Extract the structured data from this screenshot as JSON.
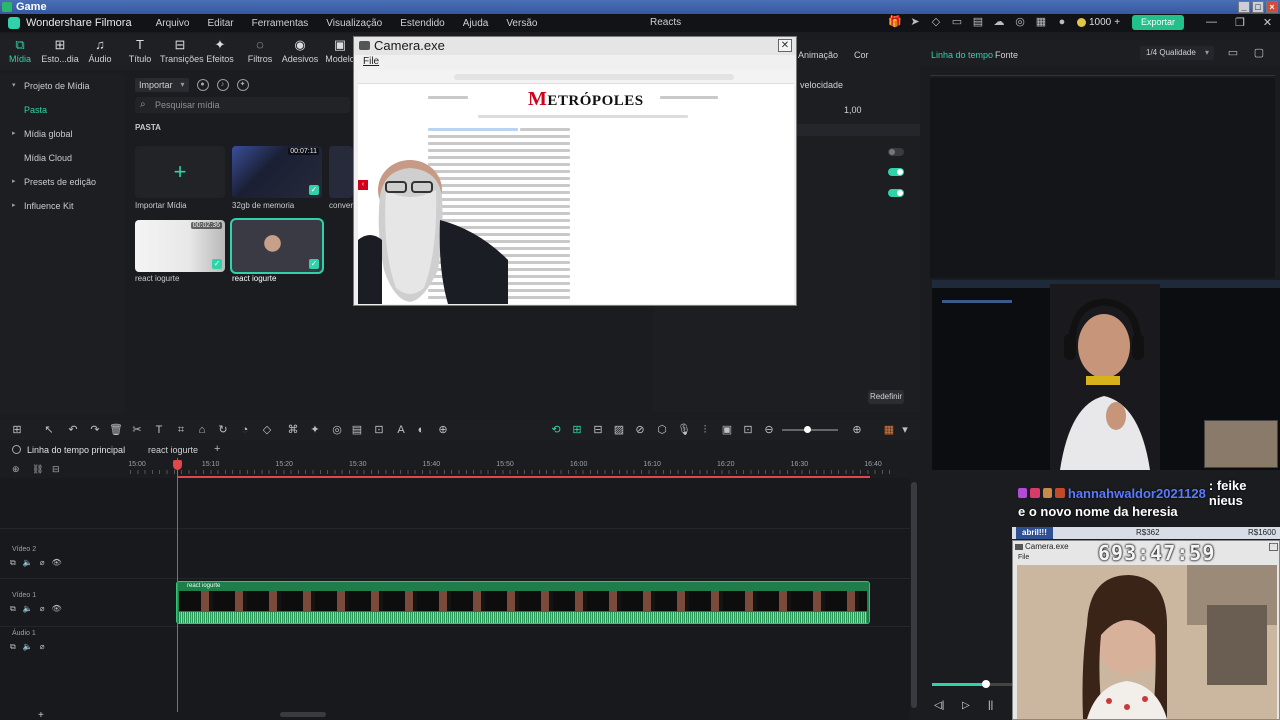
{
  "outer_window": {
    "title": "Game"
  },
  "menubar": {
    "brand": "Wondershare Filmora",
    "items": [
      "Arquivo",
      "Editar",
      "Ferramentas",
      "Visualização",
      "Estendido",
      "Ajuda",
      "Versão"
    ],
    "project_name": "Reacts",
    "credits": "1000",
    "export_label": "Exportar"
  },
  "media_tabs": [
    {
      "label": "Mídia",
      "icon": "media-icon"
    },
    {
      "label": "Esto...dia",
      "icon": "stock-media-icon"
    },
    {
      "label": "Áudio",
      "icon": "audio-icon"
    },
    {
      "label": "Título",
      "icon": "title-icon"
    },
    {
      "label": "Transições",
      "icon": "transitions-icon"
    },
    {
      "label": "Efeitos",
      "icon": "effects-icon"
    },
    {
      "label": "Filtros",
      "icon": "filters-icon"
    },
    {
      "label": "Adesivos",
      "icon": "stickers-icon"
    },
    {
      "label": "Modelo",
      "icon": "template-icon"
    }
  ],
  "left_nav": {
    "items": [
      {
        "label": "Projeto de Mídia",
        "caret": "▾"
      },
      {
        "label": "Pasta",
        "caret": ""
      },
      {
        "label": "Mídia global",
        "caret": "▸"
      },
      {
        "label": "Mídia Cloud",
        "caret": ""
      },
      {
        "label": "Presets de edição",
        "caret": "▸"
      },
      {
        "label": "Influence Kit",
        "caret": "▸"
      }
    ]
  },
  "media": {
    "import_dropdown": "Importar",
    "search_placeholder": "Pesquisar mídia",
    "section_label": "PASTA",
    "tiles": [
      {
        "label": "Importar Mídia",
        "duration": ""
      },
      {
        "label": "32gb de memoria",
        "duration": "00:07:11"
      },
      {
        "label": "conver",
        "duration": ""
      },
      {
        "label": "react iogurte",
        "duration": "00:02:36"
      },
      {
        "label": "react iogurte",
        "duration": ""
      }
    ]
  },
  "properties": {
    "tabs": [
      "Animação",
      "Cor"
    ],
    "speed_label": "velocidade",
    "speed_value": "1,00",
    "reset_label": "Redefinir"
  },
  "camera_window": {
    "title": "Camera.exe",
    "file_menu": "File",
    "site_logo": "ETRÓPOLES",
    "site_logo_m": "M"
  },
  "preview": {
    "tab_timeline": "Linha do tempo",
    "tab_source": "Fonte",
    "quality": "1/4 Qualidade"
  },
  "stream": {
    "chat_username": "hannahwaldor2021128",
    "chat_line1": ": feike nieus",
    "chat_line2": "e o novo nome da heresia",
    "bar_left": "abril!!!",
    "bar_mid": "R$362",
    "bar_right": "R$1600",
    "cam2_title": "Camera.exe",
    "cam2_file": "File",
    "timer": "693:47:59"
  },
  "timeline": {
    "main_label": "Linha do tempo principal",
    "sub_label": "react iogurte",
    "ruler_labels": [
      "15:00",
      "15:10",
      "15:20",
      "15:30",
      "15:40",
      "15:50",
      "16:00",
      "16:10",
      "16:20",
      "16:30",
      "16:40"
    ],
    "tracks": [
      "Vídeo 2",
      "Vídeo 1",
      "Áudio 1"
    ],
    "clip_name": "react iogurte"
  }
}
